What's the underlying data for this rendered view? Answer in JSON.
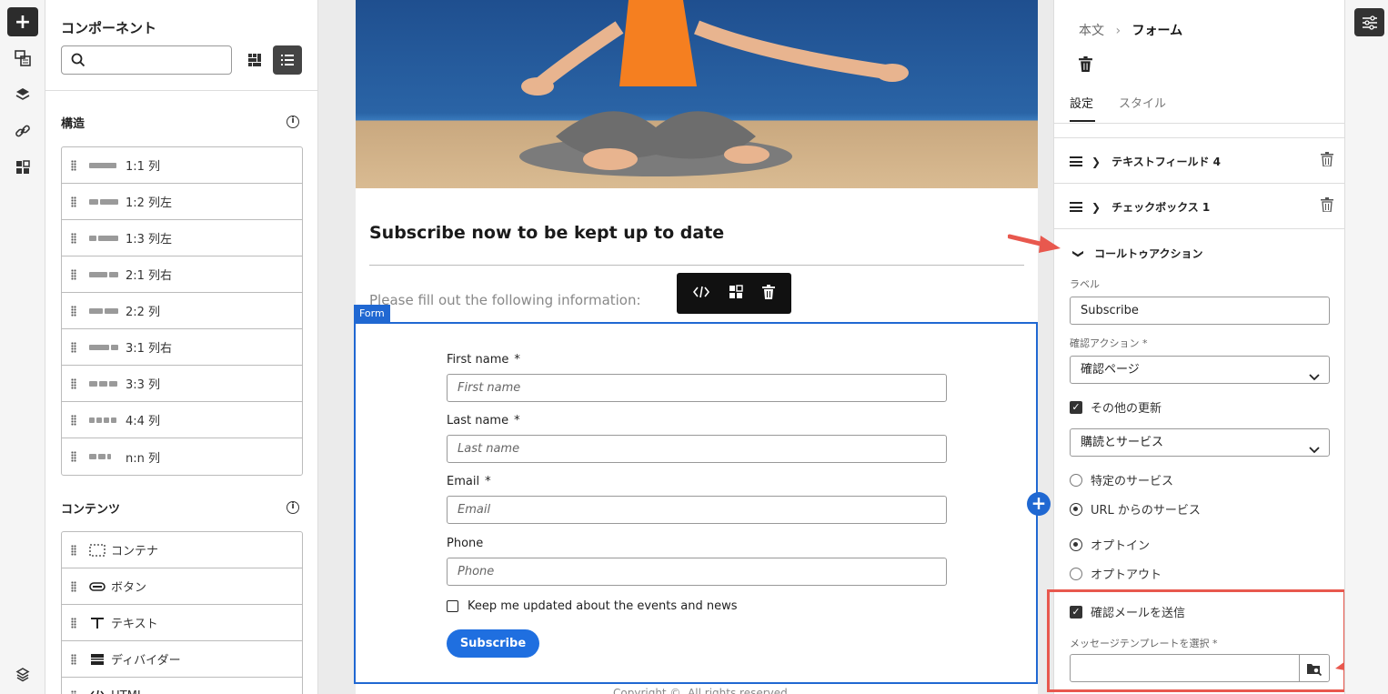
{
  "rail": {
    "icons": [
      "plus-icon",
      "image-text-icon",
      "layers-icon",
      "link-icon",
      "widgets-icon",
      "layers-gear-icon"
    ]
  },
  "components": {
    "title": "コンポーネント",
    "search_placeholder": "",
    "structure": {
      "title": "構造",
      "items": [
        {
          "label": "1:1 列",
          "icon": [
            30
          ]
        },
        {
          "label": "1:2 列左",
          "icon": [
            10,
            20
          ]
        },
        {
          "label": "1:3 列左",
          "icon": [
            8,
            22
          ]
        },
        {
          "label": "2:1 列右",
          "icon": [
            20,
            10
          ]
        },
        {
          "label": "2:2 列",
          "icon": [
            15,
            15
          ]
        },
        {
          "label": "3:1 列右",
          "icon": [
            22,
            8
          ]
        },
        {
          "label": "3:3 列",
          "icon": [
            9,
            9,
            9
          ]
        },
        {
          "label": "4:4 列",
          "icon": [
            6,
            6,
            6,
            6
          ]
        },
        {
          "label": "n:n 列",
          "icon": [
            8,
            8,
            4
          ]
        }
      ]
    },
    "contents": {
      "title": "コンテンツ",
      "items": [
        {
          "label": "コンテナ",
          "icon": "container-icon"
        },
        {
          "label": "ボタン",
          "icon": "button-icon"
        },
        {
          "label": "テキスト",
          "icon": "text-icon"
        },
        {
          "label": "ディバイダー",
          "icon": "divider-icon"
        },
        {
          "label": "HTML",
          "icon": "html-icon"
        }
      ]
    }
  },
  "email": {
    "title": "Subscribe now to be kept up to date",
    "intro": "Please fill out the following information:",
    "form_tag": "Form",
    "fields": [
      {
        "label": "First name",
        "required": "*",
        "placeholder": "First name"
      },
      {
        "label": "Last name",
        "required": "*",
        "placeholder": "Last name"
      },
      {
        "label": "Email",
        "required": "*",
        "placeholder": "Email"
      },
      {
        "label": "Phone",
        "required": "",
        "placeholder": "Phone"
      }
    ],
    "checkbox_label": "Keep me updated about the events and news",
    "subscribe_button": "Subscribe",
    "copyright": "Copyright ©. All rights reserved."
  },
  "props": {
    "breadcrumb_parent": "本文",
    "breadcrumb_current": "フォーム",
    "tabs": [
      "設定",
      "スタイル"
    ],
    "collapsed_items": [
      "テキストフィールド 4",
      "チェックボックス 1"
    ],
    "cta_section": "コールトゥアクション",
    "label_caption": "ラベル",
    "label_value": "Subscribe",
    "confirm_action_caption": "確認アクション",
    "confirm_action_value": "確認ページ",
    "other_updates_label": "その他の更新",
    "service_select_value": "購読とサービス",
    "radio_service": [
      "特定のサービス",
      "URL からのサービス"
    ],
    "radio_service_selected": 1,
    "radio_opt": [
      "オプトイン",
      "オプトアウト"
    ],
    "radio_opt_selected": 0,
    "send_confirm_label": "確認メールを送信",
    "template_caption": "メッセージテンプレートを選択",
    "required_mark": "*"
  },
  "colors": {
    "accent": "#2068d2",
    "button": "#1f6fe0",
    "callout": "#e8584e"
  }
}
